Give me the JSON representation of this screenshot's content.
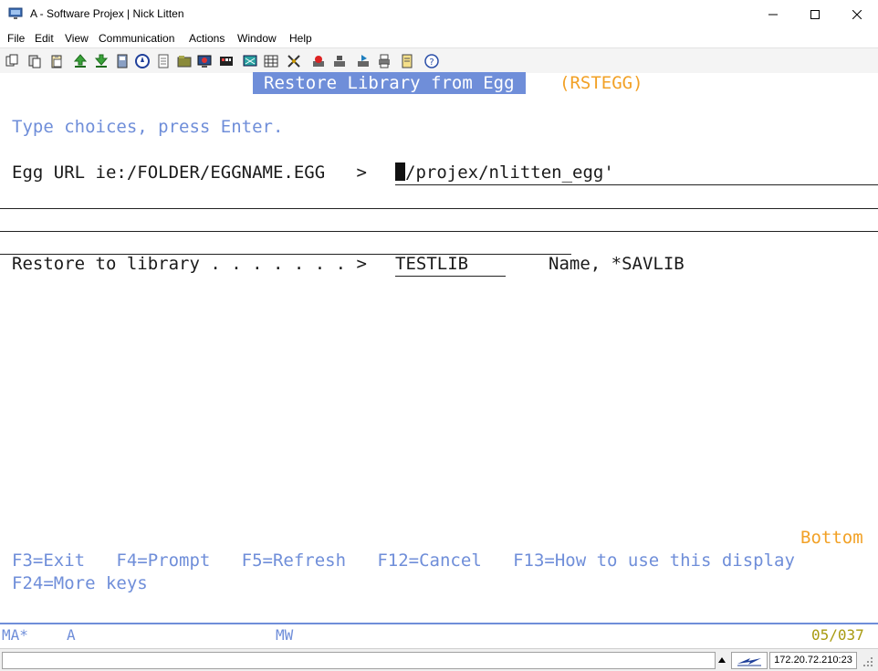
{
  "window": {
    "title": "A - Software Projex | Nick Litten"
  },
  "menu": {
    "items": [
      "File",
      "Edit",
      "View",
      "Communication",
      "Actions",
      "Window",
      "Help"
    ]
  },
  "toolbar": {
    "icons": [
      "copy-icon",
      "paste-icon",
      "clipboard-icon",
      "upload-icon",
      "download-icon",
      "disk-icon",
      "compass-icon",
      "document-icon",
      "folder-icon",
      "display-icon",
      "keyboard-icon",
      "grid-icon",
      "macro-icon",
      "record-icon",
      "stop-icon",
      "play-icon",
      "print-icon",
      "notes-icon",
      "help-icon"
    ]
  },
  "screen": {
    "title": "Restore Library from Egg",
    "command": "(RSTEGG)",
    "instruction": "Type choices, press Enter.",
    "egg_url_label": "Egg URL ie:/FOLDER/EGGNAME.EGG   >",
    "egg_url_value_first": "'",
    "egg_url_value_rest": "/projex/nlitten_egg'",
    "restore_label": "Restore to library . . . . . . . >",
    "restore_value": "TESTLIB",
    "restore_hint": "Name, *SAVLIB",
    "more": "Bottom",
    "fkeys_line1": "F3=Exit   F4=Prompt   F5=Refresh   F12=Cancel   F13=How to use this display",
    "fkeys_line2": "F24=More keys"
  },
  "status": {
    "left": "MA*",
    "session": "A",
    "mode": "MW",
    "position": "05/037"
  },
  "bottom": {
    "ip": "172.20.72.210:23"
  },
  "colors": {
    "field_blue": "#6f8ed9",
    "highlight_orange": "#f2a126"
  }
}
